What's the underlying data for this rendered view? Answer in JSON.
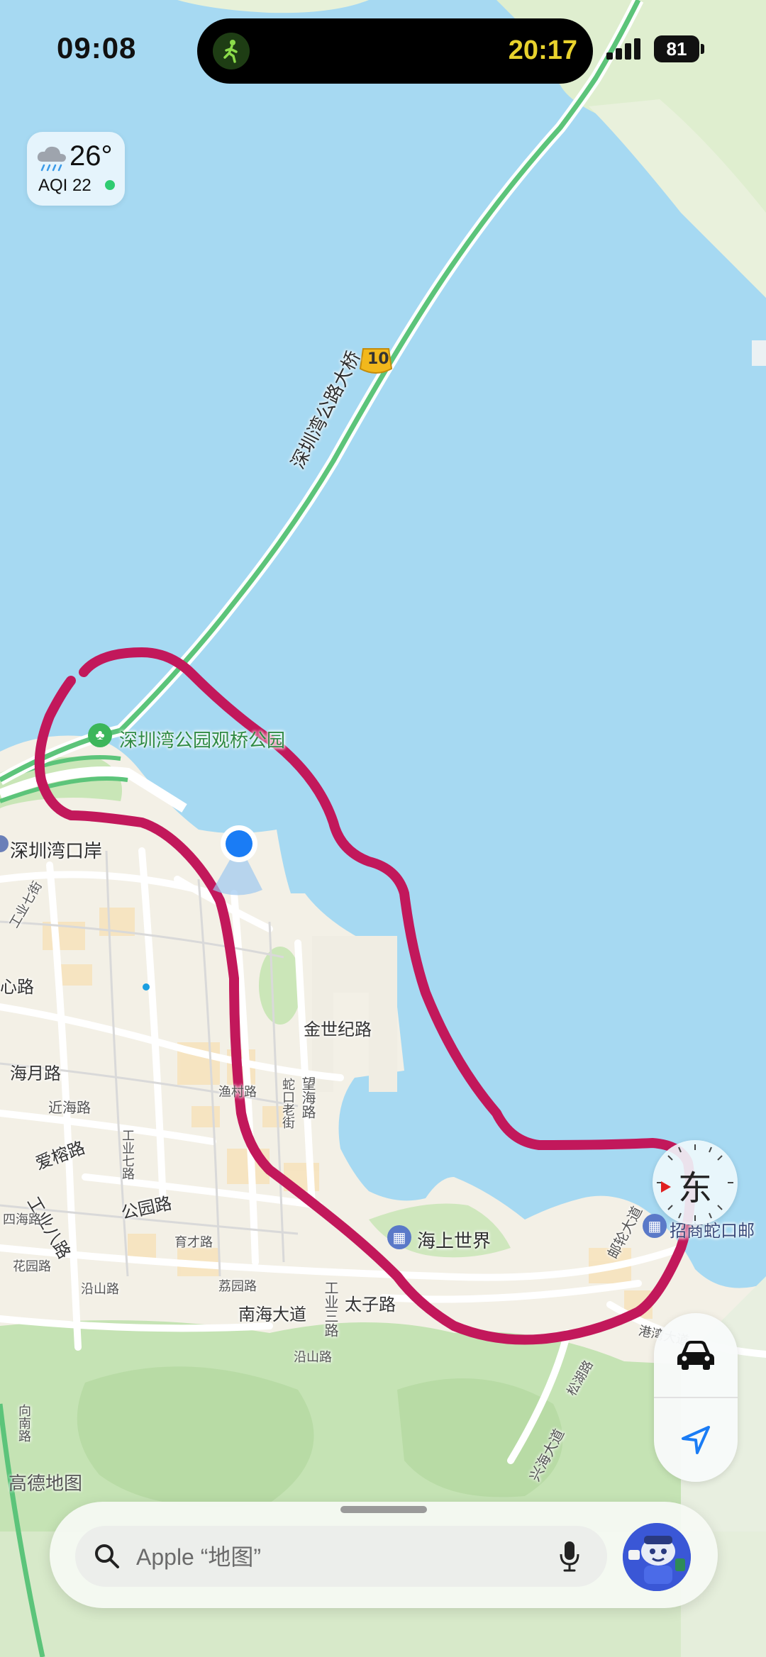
{
  "status_bar": {
    "time": "09:08",
    "activity_timer": "20:17",
    "battery": "81",
    "activity_icon": "walking-person-icon"
  },
  "weather": {
    "temperature": "26°",
    "aqi_label": "AQI 22",
    "icon": "rain-cloud-icon",
    "aqi_status_color": "#2ecc71"
  },
  "map": {
    "bridge_name": "深圳湾公路大桥",
    "route_shield": "10",
    "labels": {
      "park": "深圳湾公园观桥公园",
      "port": "深圳湾口岸",
      "road_jinshiji": "金世纪路",
      "road_wanghai": "望海路",
      "road_shekou_old": "蛇口老街",
      "road_yucun": "渔村路",
      "road_haiyue": "海月路",
      "road_xinyou": "心路",
      "road_jinhai": "近海路",
      "road_airong": "爱榕路",
      "road_gongye8": "工业八路",
      "road_gongye7": "工业七路",
      "road_gongye7jie": "工业七街",
      "road_gongyuan": "公园路",
      "road_sihai": "四海路",
      "road_yucai": "育才路",
      "road_huayuan": "花园路",
      "road_liyuan": "荔园路",
      "road_nanhai": "南海大道",
      "road_taizi": "太子路",
      "road_gongye3": "工业三路",
      "road_yanshan": "沿山路",
      "road_yanshan2": "沿山路",
      "road_xiangnan": "向南路",
      "road_youlun": "邮轮大道",
      "road_gangwan": "港湾大道",
      "road_songhu": "松湖路",
      "road_xinghai": "兴海大道",
      "haishang_shijie": "海上世界",
      "zhaoshang_shekou": "招商蛇口邮"
    },
    "brand_watermark": "高德地图",
    "compass_label": "东",
    "colors": {
      "water": "#a6d9f2",
      "land": "#f3f0e6",
      "green": "#c5e3b4",
      "highway": "#5cc47a",
      "drawn_loop": "#c2185b",
      "location_dot": "#1a7cf5"
    }
  },
  "controls": {
    "drive_icon": "car-icon",
    "locate_icon": "location-arrow-icon"
  },
  "search_bar": {
    "placeholder": "Apple “地图”",
    "search_icon": "search-icon",
    "mic_icon": "microphone-icon",
    "avatar_icon": "memoji-avatar-icon"
  }
}
